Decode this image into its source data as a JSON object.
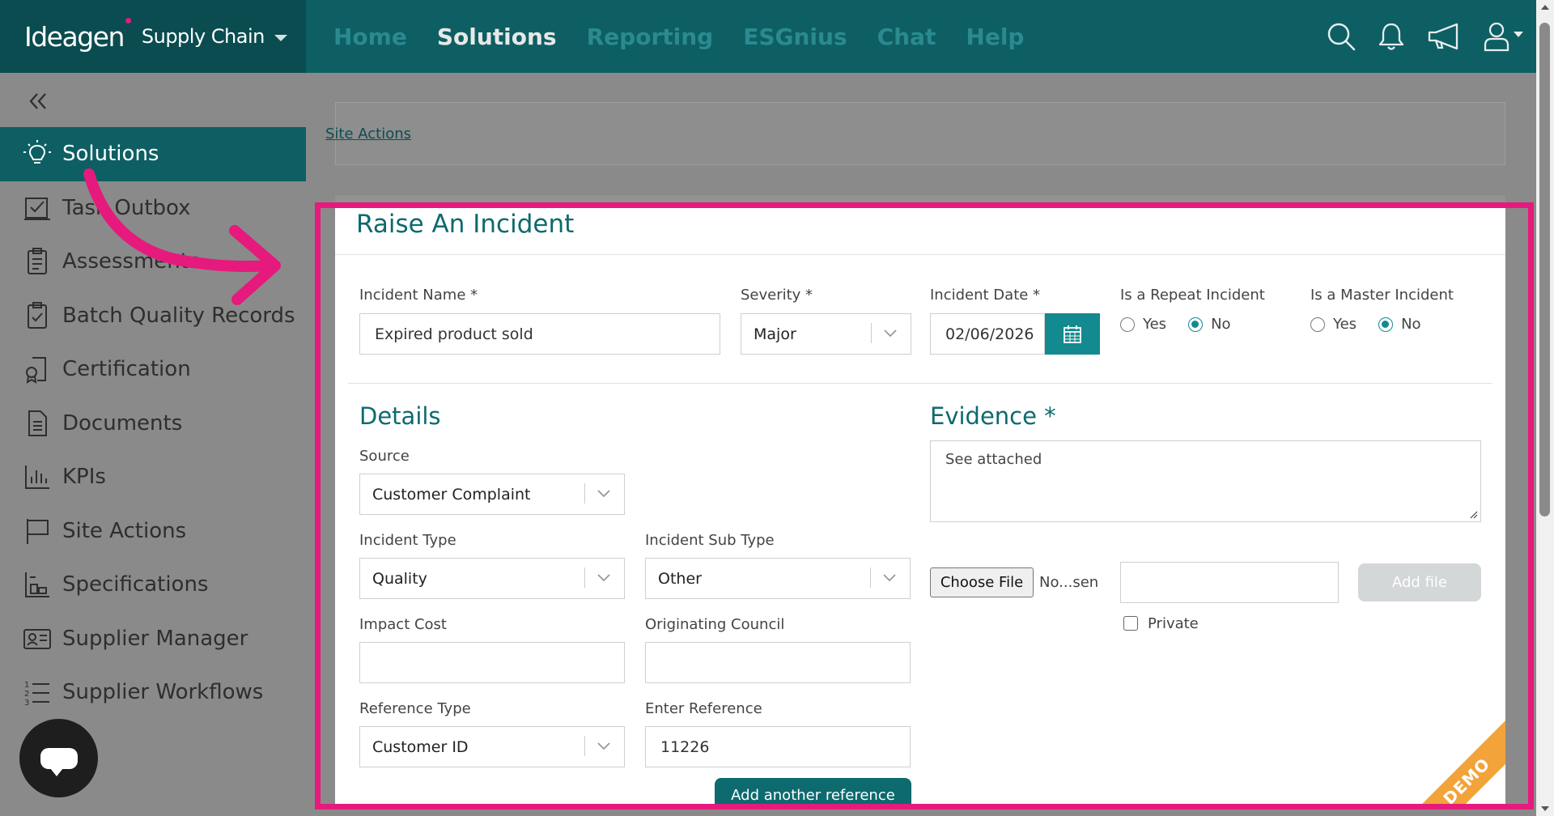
{
  "brand": {
    "logo": "Ideagen",
    "product": "Supply Chain"
  },
  "nav": [
    {
      "label": "Home",
      "active": false
    },
    {
      "label": "Solutions",
      "active": true
    },
    {
      "label": "Reporting",
      "active": false
    },
    {
      "label": "ESGnius",
      "active": false
    },
    {
      "label": "Chat",
      "active": false
    },
    {
      "label": "Help",
      "active": false
    }
  ],
  "top_icons": [
    "search-icon",
    "bell-icon",
    "megaphone-icon",
    "user-icon"
  ],
  "sidebar": {
    "items": [
      {
        "label": "Solutions",
        "icon": "lightbulb-icon",
        "active": true
      },
      {
        "label": "Task Outbox",
        "icon": "outbox-icon"
      },
      {
        "label": "Assessments",
        "icon": "clipboard-icon"
      },
      {
        "label": "Batch Quality Records",
        "icon": "clipboard-check-icon"
      },
      {
        "label": "Certification",
        "icon": "certificate-icon"
      },
      {
        "label": "Documents",
        "icon": "document-icon"
      },
      {
        "label": "KPIs",
        "icon": "bar-chart-icon"
      },
      {
        "label": "Site Actions",
        "icon": "flag-icon"
      },
      {
        "label": "Specifications",
        "icon": "spec-icon"
      },
      {
        "label": "Supplier Manager",
        "icon": "id-card-icon"
      },
      {
        "label": "Supplier Workflows",
        "icon": "list-icon"
      }
    ]
  },
  "breadcrumb": "Site Actions",
  "form": {
    "title": "Raise An Incident",
    "incident_name": {
      "label": "Incident Name *",
      "value": "Expired product sold"
    },
    "severity": {
      "label": "Severity *",
      "value": "Major"
    },
    "incident_date": {
      "label": "Incident Date *",
      "value": "02/06/2026"
    },
    "repeat": {
      "label": "Is a Repeat Incident",
      "yes": "Yes",
      "no": "No",
      "selected": "No"
    },
    "master": {
      "label": "Is a Master Incident",
      "yes": "Yes",
      "no": "No",
      "selected": "No"
    },
    "details_title": "Details",
    "source": {
      "label": "Source",
      "value": "Customer Complaint"
    },
    "incident_type": {
      "label": "Incident Type",
      "value": "Quality"
    },
    "incident_sub_type": {
      "label": "Incident Sub Type",
      "value": "Other"
    },
    "impact_cost": {
      "label": "Impact Cost",
      "value": ""
    },
    "originating_council": {
      "label": "Originating Council",
      "value": ""
    },
    "reference_type": {
      "label": "Reference Type",
      "value": "Customer ID"
    },
    "enter_reference": {
      "label": "Enter Reference",
      "value": "11226"
    },
    "add_reference_button": "Add another reference",
    "evidence_title": "Evidence *",
    "evidence_text": "See attached",
    "choose_file": "Choose File",
    "no_file": "No...sen",
    "add_file": "Add file",
    "private": "Private",
    "demo_ribbon": "DEMO"
  },
  "colors": {
    "teal_dark": "#0a4c50",
    "teal": "#0d5f63",
    "accent": "#138a8f",
    "highlight": "#e6197d",
    "ribbon": "#f2a33a"
  }
}
